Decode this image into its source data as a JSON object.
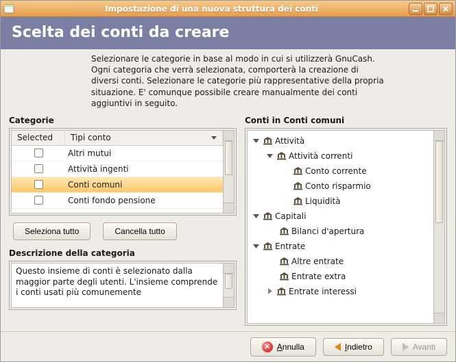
{
  "window": {
    "title": "Impostazione di una nuova struttura dei conti"
  },
  "banner": {
    "heading": "Scelta dei conti da creare"
  },
  "intro": "Selezionare le categorie in base al modo in cui si utilizzerà GnuCash. Ogni categoria che verrà selezionata, comporterà la creazione di diversi conti. Selezionare le categorie più rappresentative della propria situazione. E' comunque possibile creare manualmente dei conti aggiuntivi in seguito.",
  "left": {
    "label": "Categorie",
    "head": {
      "selected": "Selected",
      "tipo": "Tipi conto"
    },
    "rows": [
      {
        "label": "Altri mutui",
        "checked": false,
        "selected": false
      },
      {
        "label": "Attività ingenti",
        "checked": false,
        "selected": false
      },
      {
        "label": "Conti comuni",
        "checked": false,
        "selected": true
      },
      {
        "label": "Conti fondo pensione",
        "checked": false,
        "selected": false
      }
    ],
    "buttons": {
      "select_all": "Seleziona tutto",
      "clear_all": "Cancella tutto"
    },
    "desc_label": "Descrizione della categoria",
    "desc_text": "Questo insieme di conti è selezionato dalla maggior parte degli utenti. L'insieme comprende i conti usati più comunemente"
  },
  "right": {
    "label": "Conti in Conti comuni",
    "items": [
      {
        "indent": 0,
        "expander": "down",
        "icon": "bank",
        "label": "Attività"
      },
      {
        "indent": 1,
        "expander": "down",
        "icon": "bank",
        "label": "Attività correnti"
      },
      {
        "indent": 2,
        "expander": null,
        "icon": "bank",
        "label": "Conto corrente"
      },
      {
        "indent": 2,
        "expander": null,
        "icon": "bank",
        "label": "Conto risparmio"
      },
      {
        "indent": 2,
        "expander": null,
        "icon": "bank",
        "label": "Liquidità"
      },
      {
        "indent": 0,
        "expander": "down",
        "icon": "bank",
        "label": "Capitali"
      },
      {
        "indent": 1,
        "expander": null,
        "icon": "bank",
        "label": "Bilanci d'apertura"
      },
      {
        "indent": 0,
        "expander": "down",
        "icon": "bank",
        "label": "Entrate"
      },
      {
        "indent": 1,
        "expander": null,
        "icon": "bank",
        "label": "Altre entrate"
      },
      {
        "indent": 1,
        "expander": null,
        "icon": "bank",
        "label": "Entrate extra"
      },
      {
        "indent": 1,
        "expander": "right",
        "icon": "bank",
        "label": "Entrate interessi"
      }
    ]
  },
  "footer": {
    "cancel": "Annulla",
    "back": "Indietro",
    "forward": "Avanti"
  }
}
